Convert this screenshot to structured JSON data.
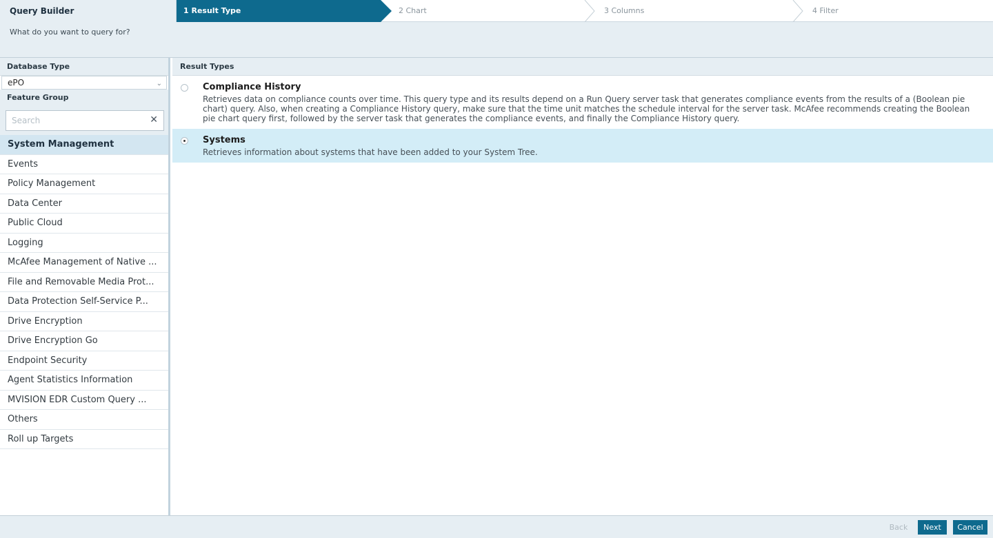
{
  "app": {
    "title": "Query Builder"
  },
  "steps": [
    {
      "label": "1 Result Type",
      "active": true
    },
    {
      "label": "2 Chart",
      "active": false
    },
    {
      "label": "3 Columns",
      "active": false
    },
    {
      "label": "4 Filter",
      "active": false
    }
  ],
  "question": "What do you want to query for?",
  "left": {
    "database_type_label": "Database Type",
    "database_type_value": "ePO",
    "feature_group_label": "Feature Group",
    "search_placeholder": "Search",
    "search_value": "",
    "feature_groups": [
      "System Management",
      "Events",
      "Policy Management",
      "Data Center",
      "Public Cloud",
      "Logging",
      "McAfee Management of Native ...",
      "File and Removable Media Prot...",
      "Data Protection Self-Service P...",
      "Drive Encryption",
      "Drive Encryption Go",
      "Endpoint Security",
      "Agent Statistics Information",
      "MVISION EDR Custom Query ...",
      "Others",
      "Roll up Targets"
    ],
    "selected_feature_group": "System Management"
  },
  "right": {
    "result_types_label": "Result Types",
    "options": [
      {
        "title": "Compliance History",
        "description": "Retrieves data on compliance counts over time. This query type and its results depend on a Run Query server task that generates compliance events from the results of a (Boolean pie chart) query. Also, when creating a Compliance History query, make sure that the time unit matches the schedule interval for the server task. McAfee recommends creating the Boolean pie chart query first, followed by the server task that generates the compliance events, and finally the Compliance History query.",
        "selected": false
      },
      {
        "title": "Systems",
        "description": "Retrieves information about systems that have been added to your System Tree.",
        "selected": true
      }
    ]
  },
  "footer": {
    "back_label": "Back",
    "next_label": "Next",
    "cancel_label": "Cancel"
  },
  "colors": {
    "accent": "#0e6a8e",
    "band": "#e6eef3",
    "selected_row": "#d3edf7"
  }
}
